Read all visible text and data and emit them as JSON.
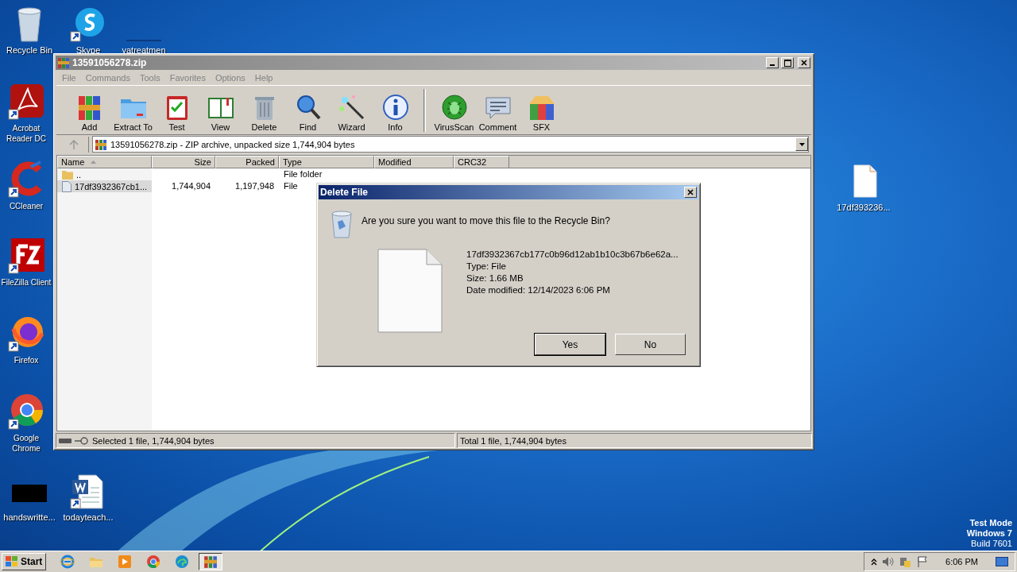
{
  "desktop": {
    "icons": [
      {
        "label": "Recycle Bin",
        "kind": "recycle"
      },
      {
        "label": "Skype",
        "kind": "skype"
      },
      {
        "label": "yatreatmen",
        "kind": "blank"
      },
      {
        "label": "Acrobat Reader DC",
        "kind": "acrobat"
      },
      {
        "label": "CCleaner",
        "kind": "ccleaner"
      },
      {
        "label": "FileZilla Client",
        "kind": "filezilla"
      },
      {
        "label": "Firefox",
        "kind": "firefox"
      },
      {
        "label": "Google Chrome",
        "kind": "chrome"
      },
      {
        "label": "handswritte...",
        "kind": "thumb"
      },
      {
        "label": "todayteach...",
        "kind": "word"
      },
      {
        "label": "17df393236...",
        "kind": "file"
      }
    ],
    "os_notice": [
      "Test Mode",
      "Windows 7",
      "Build 7601"
    ]
  },
  "archive_window": {
    "title": "13591056278.zip",
    "menu": [
      "File",
      "Commands",
      "Tools",
      "Favorites",
      "Options",
      "Help"
    ],
    "toolbar": [
      {
        "label": "Add",
        "kind": "add"
      },
      {
        "label": "Extract To",
        "kind": "extract"
      },
      {
        "label": "Test",
        "kind": "test"
      },
      {
        "label": "View",
        "kind": "view"
      },
      {
        "label": "Delete",
        "kind": "delete"
      },
      {
        "label": "Find",
        "kind": "find"
      },
      {
        "label": "Wizard",
        "kind": "wizard"
      },
      {
        "label": "Info",
        "kind": "info"
      },
      {
        "label": "VirusScan",
        "kind": "virus",
        "group_start": true
      },
      {
        "label": "Comment",
        "kind": "comment"
      },
      {
        "label": "SFX",
        "kind": "sfx"
      }
    ],
    "address": "13591056278.zip - ZIP archive, unpacked size 1,744,904 bytes",
    "columns": [
      {
        "label": "Name",
        "sorted": true
      },
      {
        "label": "Size",
        "sorted": false
      },
      {
        "label": "Packed",
        "sorted": false
      },
      {
        "label": "Type",
        "sorted": false
      },
      {
        "label": "Modified",
        "sorted": false
      },
      {
        "label": "CRC32",
        "sorted": false
      }
    ],
    "rows": [
      {
        "kind": "folder",
        "selected": false,
        "cells": [
          "..",
          null,
          null,
          "File folder",
          null,
          null
        ]
      },
      {
        "kind": "file",
        "selected": true,
        "cells": [
          "17df3932367cb1...",
          "1,744,904",
          "1,197,948",
          "File",
          null,
          null
        ]
      }
    ],
    "status": {
      "left": "Selected 1 file, 1,744,904 bytes",
      "right": "Total 1 file, 1,744,904 bytes"
    }
  },
  "dialog": {
    "title": "Delete File",
    "message": "Are you sure you want to move this file to the Recycle Bin?",
    "file_name": "17df3932367cb177c0b96d12ab1b10c3b67b6e62a...",
    "details": [
      "Type: File",
      "Size: 1.66 MB",
      "Date modified: 12/14/2023 6:06 PM"
    ],
    "buttons": [
      {
        "label": "Yes",
        "default": true
      },
      {
        "label": "No",
        "default": false
      }
    ]
  },
  "taskbar": {
    "start": "Start",
    "items": [
      {
        "kind": "ie",
        "selected": false
      },
      {
        "kind": "explorer",
        "selected": false
      },
      {
        "kind": "media",
        "selected": false
      },
      {
        "kind": "chrome",
        "selected": false
      },
      {
        "kind": "edge",
        "selected": false
      },
      {
        "kind": "winrar",
        "selected": true
      }
    ],
    "clock": "6:06 PM"
  }
}
